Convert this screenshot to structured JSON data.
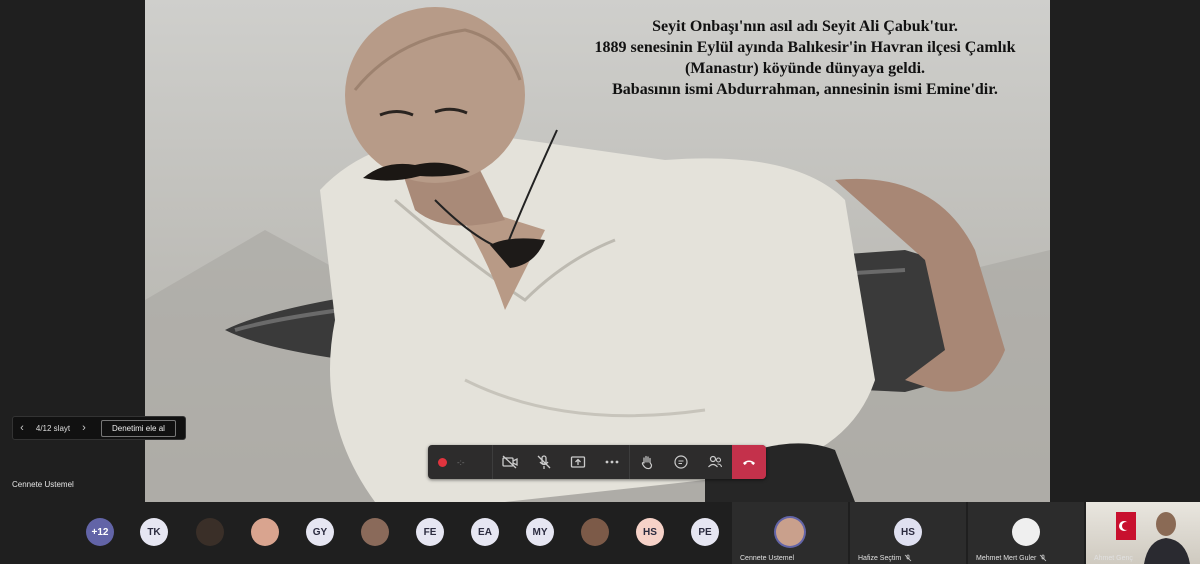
{
  "slide": {
    "lines": [
      "Seyit Onbaşı'nın asıl adı Seyit Ali Çabuk'tur.",
      "1889 senesinin Eylül ayında Balıkesir'in Havran ilçesi Çamlık",
      "(Manastır) köyünde dünyaya geldi.",
      "Babasının ismi Abdurrahman, annesinin ismi Emine'dir."
    ]
  },
  "slide_nav": {
    "counter": "4/12 slayt",
    "take_control": "Denetimi ele al"
  },
  "presenter": {
    "name": "Cennete Ustemel"
  },
  "callbar": {
    "timer": "-:-",
    "colors": {
      "record": "#e0343e",
      "hangup": "#c4314b"
    }
  },
  "participants": [
    {
      "label": "+12",
      "kind": "more"
    },
    {
      "label": "TK",
      "kind": "initials"
    },
    {
      "label": "",
      "kind": "photo",
      "color": "#3a2f28"
    },
    {
      "label": "",
      "kind": "photo",
      "color": "#d9a48f"
    },
    {
      "label": "GY",
      "kind": "initials"
    },
    {
      "label": "",
      "kind": "photo",
      "color": "#8a6a5a"
    },
    {
      "label": "FE",
      "kind": "initials"
    },
    {
      "label": "EA",
      "kind": "initials"
    },
    {
      "label": "MY",
      "kind": "initials"
    },
    {
      "label": "",
      "kind": "photo",
      "color": "#7c5a48"
    },
    {
      "label": "HS",
      "kind": "initials",
      "color": "#f6d2c8"
    },
    {
      "label": "PE",
      "kind": "initials"
    }
  ],
  "tiles": [
    {
      "name": "Cennete Ustemel",
      "avatar": "",
      "muted": false
    },
    {
      "name": "Hafize Seçtim",
      "avatar": "HS",
      "muted": true
    },
    {
      "name": "Mehmet Mert Guler",
      "avatar": "",
      "muted": true
    }
  ],
  "self": {
    "name": "Ahmet Genç"
  },
  "colors": {
    "accent": "#6264a7"
  }
}
